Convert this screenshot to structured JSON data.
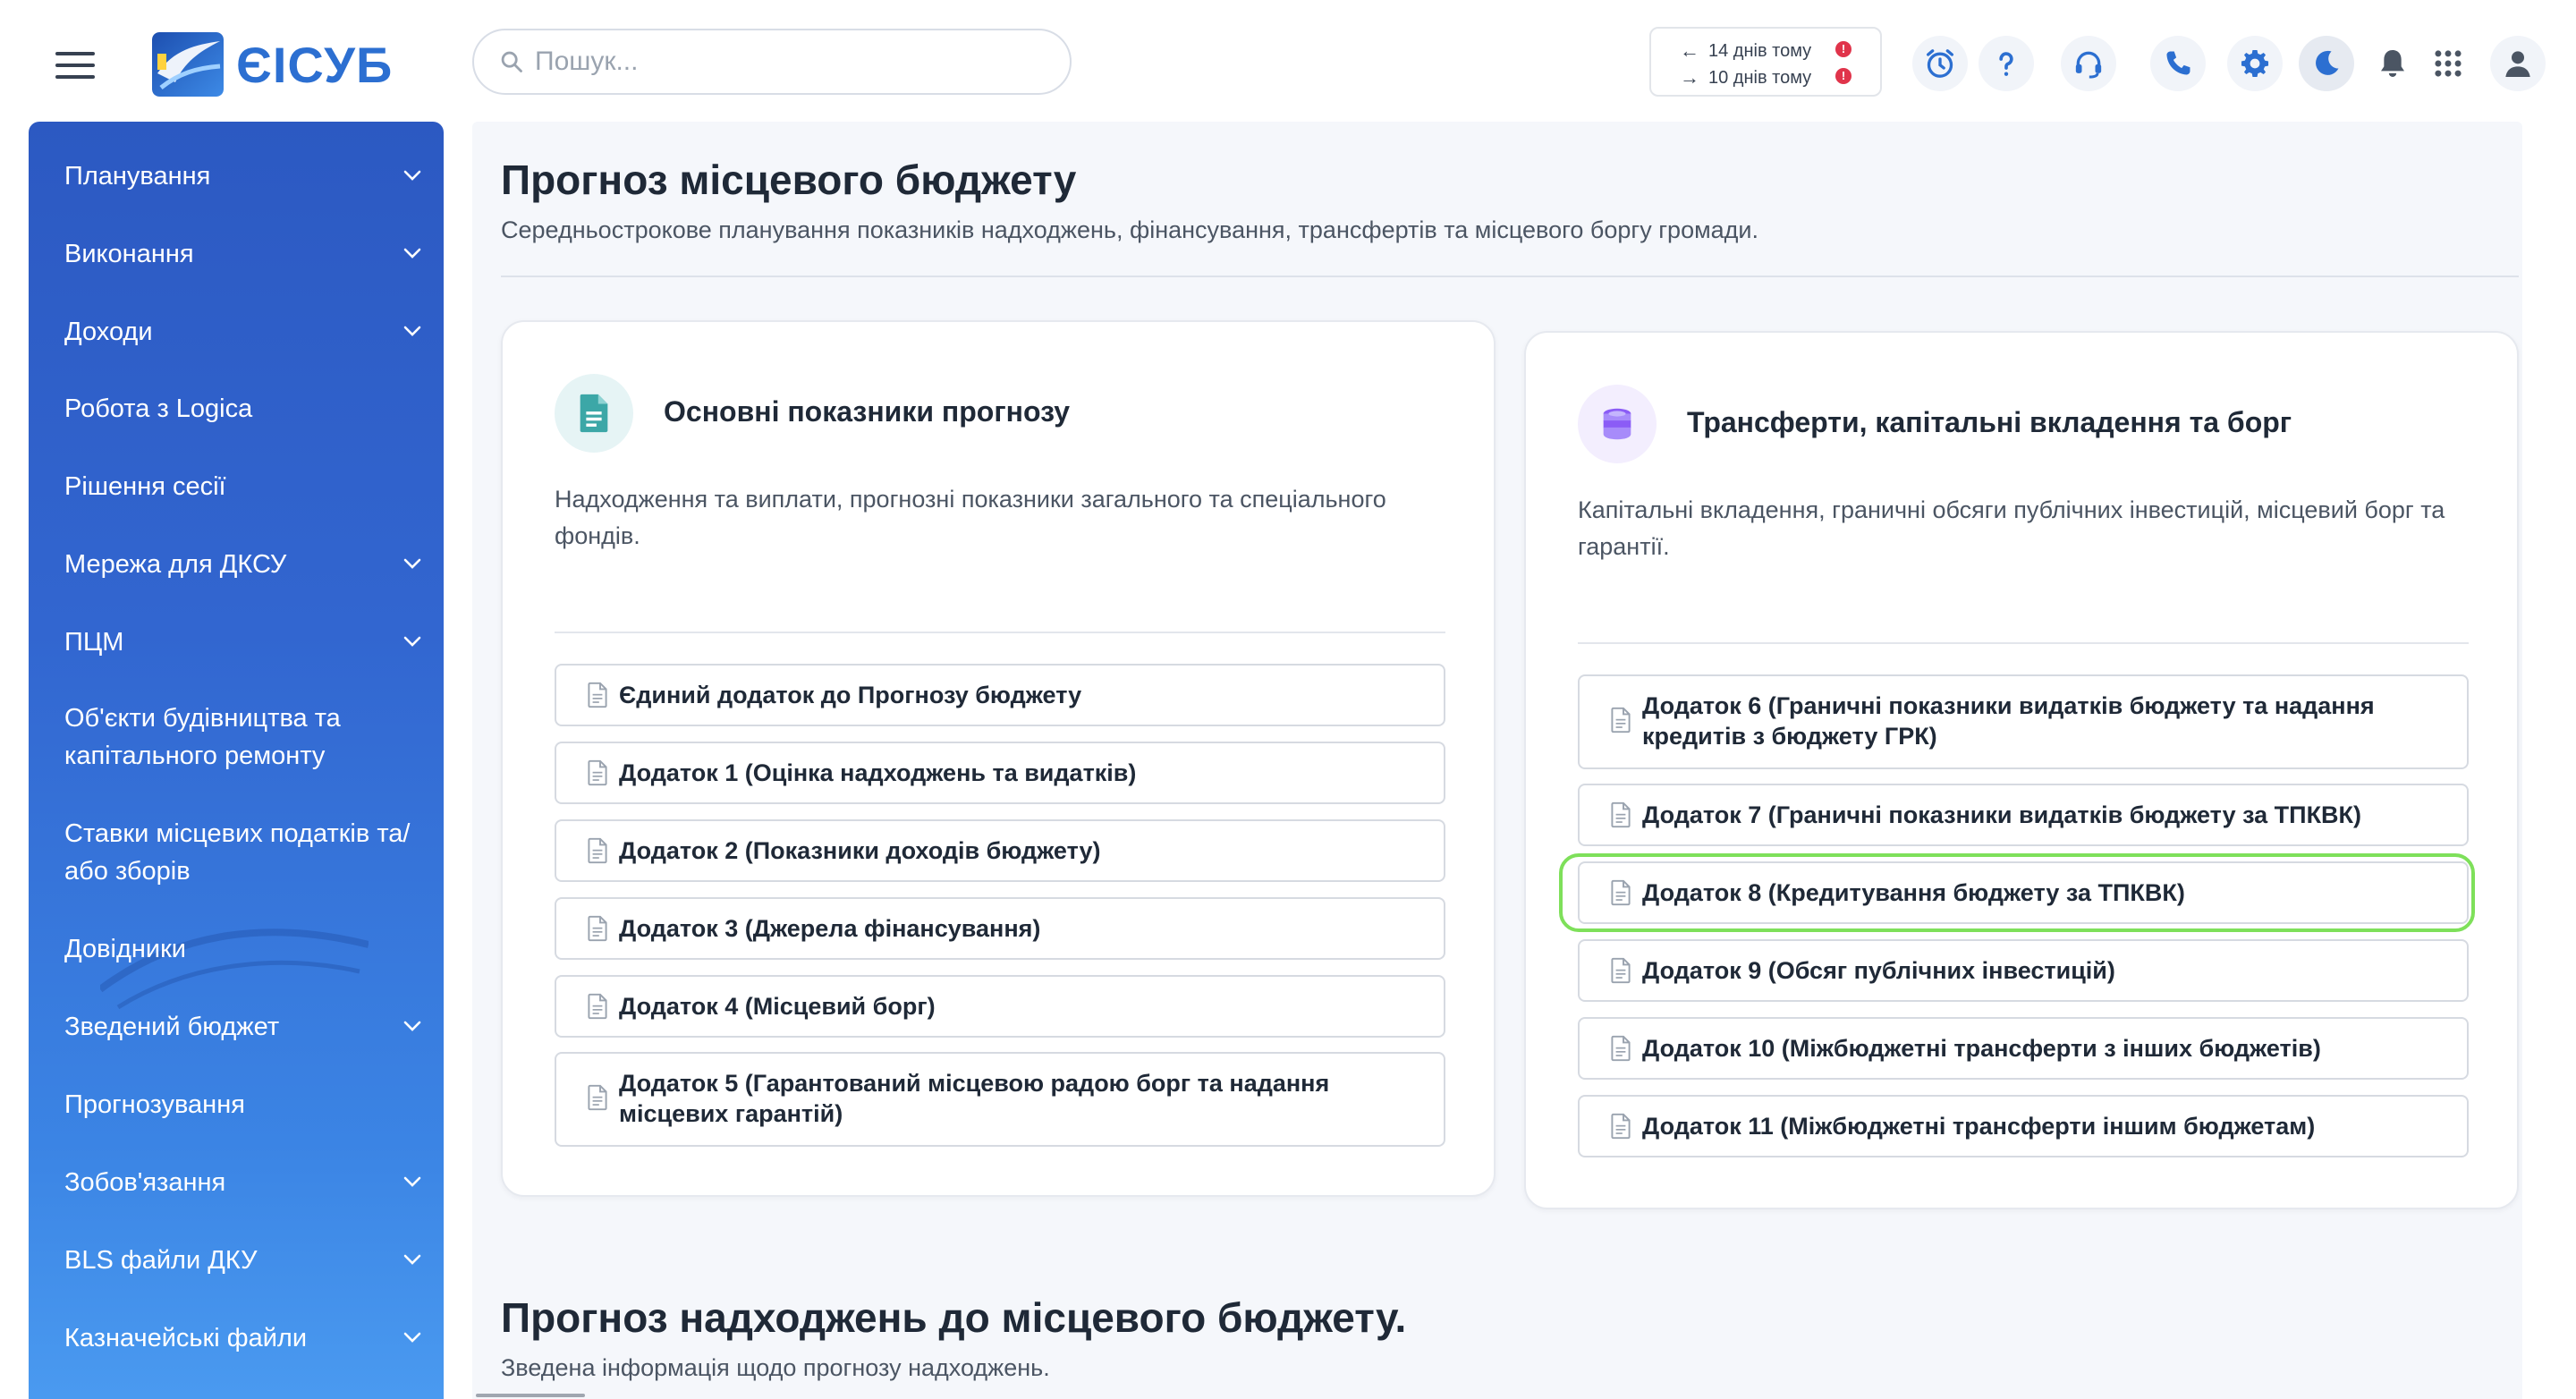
{
  "header": {
    "logo_text": "ЄІСУБ",
    "search_placeholder": "Пошук...",
    "dates": {
      "back_label": "14 днів тому",
      "forward_label": "10 днів тому",
      "alert_symbol": "!"
    },
    "icons": [
      "menu-icon",
      "alarm-clock-icon",
      "help-icon",
      "headset-icon",
      "phone-icon",
      "gear-icon",
      "moon-icon",
      "bell-icon",
      "apps-grid-icon",
      "user-icon"
    ]
  },
  "sidebar": {
    "items": [
      {
        "label": "Планування",
        "has_children": true
      },
      {
        "label": "Виконання",
        "has_children": true
      },
      {
        "label": "Доходи",
        "has_children": true
      },
      {
        "label": "Робота з Logica",
        "has_children": false
      },
      {
        "label": "Рішення сесії",
        "has_children": false
      },
      {
        "label": "Мережа для ДКСУ",
        "has_children": true
      },
      {
        "label": "ПЦМ",
        "has_children": true
      },
      {
        "label": "Об'єкти будівництва та капітального ремонту",
        "has_children": false
      },
      {
        "label": "Ставки місцевих податків та/або зборів",
        "has_children": false
      },
      {
        "label": "Довідники",
        "has_children": false
      },
      {
        "label": "Зведений бюджет",
        "has_children": true
      },
      {
        "label": "Прогнозування",
        "has_children": false
      },
      {
        "label": "Зобов'язання",
        "has_children": true
      },
      {
        "label": "BLS файли ДКУ",
        "has_children": true
      },
      {
        "label": "Казначейські файли",
        "has_children": true
      }
    ]
  },
  "main": {
    "title": "Прогноз місцевого бюджету",
    "subtitle": "Середньострокове планування показників надходжень, фінансування, трансфертів та місцевого боргу громади.",
    "cards": [
      {
        "title": "Основні показники прогнозу",
        "description": "Надходження та виплати, прогнозні показники загального та спеціального фондів.",
        "icon": "document-icon",
        "icon_color": "#3ca7a7",
        "icon_bg": "#e6f4f5",
        "buttons": [
          {
            "label": "Єдиний додаток до Прогнозу бюджету"
          },
          {
            "label": "Додаток 1 (Оцінка надходжень та видатків)"
          },
          {
            "label": "Додаток 2 (Показники доходів бюджету)"
          },
          {
            "label": "Додаток 3 (Джерела фінансування)"
          },
          {
            "label": "Додаток 4 (Місцевий борг)"
          },
          {
            "label": "Додаток 5 (Гарантований місцевою радою борг та надання місцевих гарантій)"
          }
        ]
      },
      {
        "title": "Трансферти, капітальні вкладення та борг",
        "description": "Капітальні вкладення, граничні обсяги публічних інвестицій, місцевий борг та гарантії.",
        "icon": "coins-icon",
        "icon_color": "#8b5cf6",
        "icon_bg": "#f3eefe",
        "buttons": [
          {
            "label": "Додаток 6 (Граничні показники видатків бюджету та надання кредитів з бюджету ГРК)"
          },
          {
            "label": "Додаток 7 (Граничні показники видатків бюджету за ТПКВК)"
          },
          {
            "label": "Додаток 8 (Кредитування бюджету за ТПКВК)"
          },
          {
            "label": "Додаток 9 (Обсяг публічних інвестицій)"
          },
          {
            "label": "Додаток 10 (Міжбюджетні трансферти з інших бюджетів)"
          },
          {
            "label": "Додаток 11 (Міжбюджетні трансферти іншим бюджетам)"
          }
        ]
      }
    ],
    "section2": {
      "title": "Прогноз надходжень до місцевого бюджету.",
      "subtitle": "Зведена інформація щодо прогнозу надходжень."
    }
  },
  "colors": {
    "accent": "#2c6fd1",
    "sidebar_top": "#2c59c2",
    "sidebar_bottom": "#4a9af0",
    "highlight": "#7ee05a",
    "alert": "#e0344b"
  }
}
